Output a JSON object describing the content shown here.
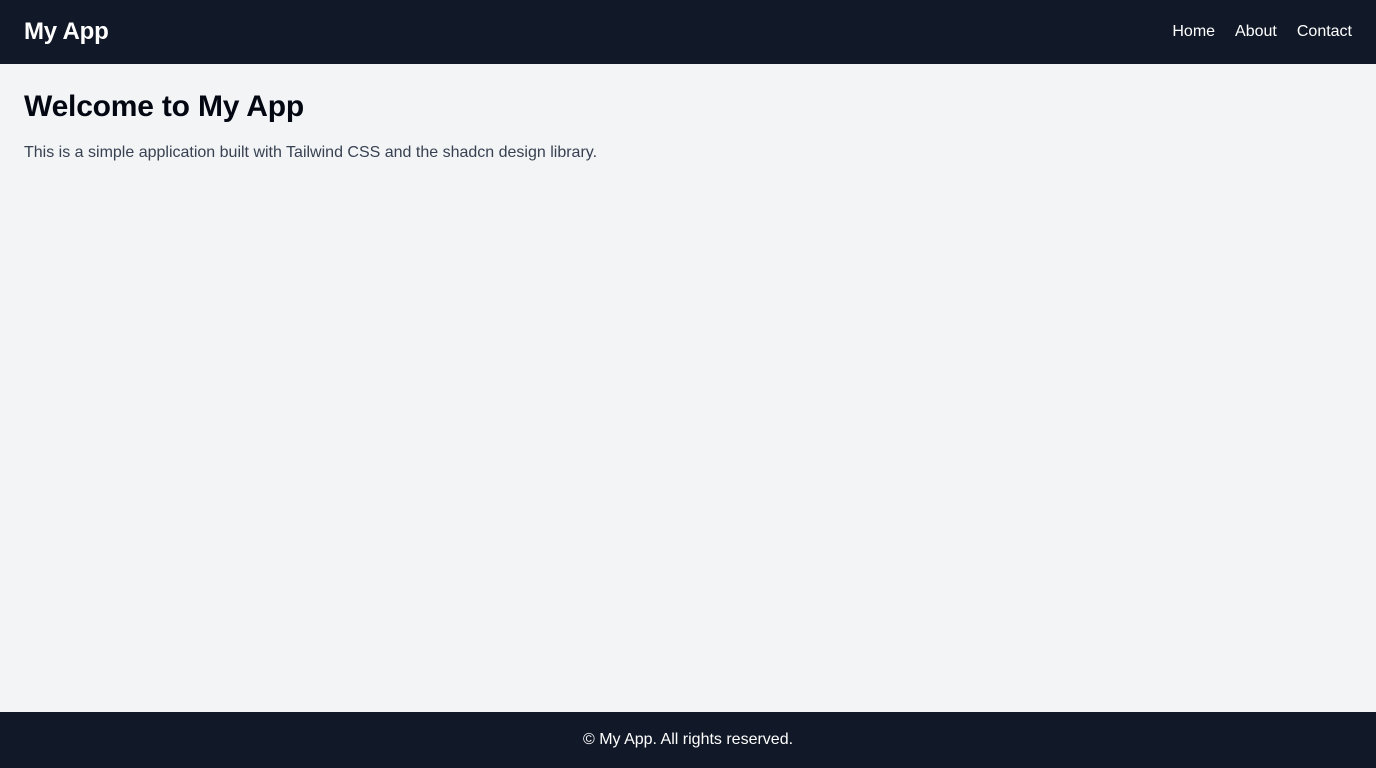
{
  "header": {
    "brand": "My App",
    "nav": [
      {
        "label": "Home"
      },
      {
        "label": "About"
      },
      {
        "label": "Contact"
      }
    ]
  },
  "main": {
    "title": "Welcome to My App",
    "description": "This is a simple application built with Tailwind CSS and the shadcn design library."
  },
  "footer": {
    "copyright": "© My App. All rights reserved."
  },
  "colors": {
    "header_background": "#111827",
    "page_background": "#f3f4f6",
    "footer_background": "#111827",
    "primary_text": "#030712",
    "secondary_text": "#374151",
    "inverse_text": "#ffffff"
  }
}
